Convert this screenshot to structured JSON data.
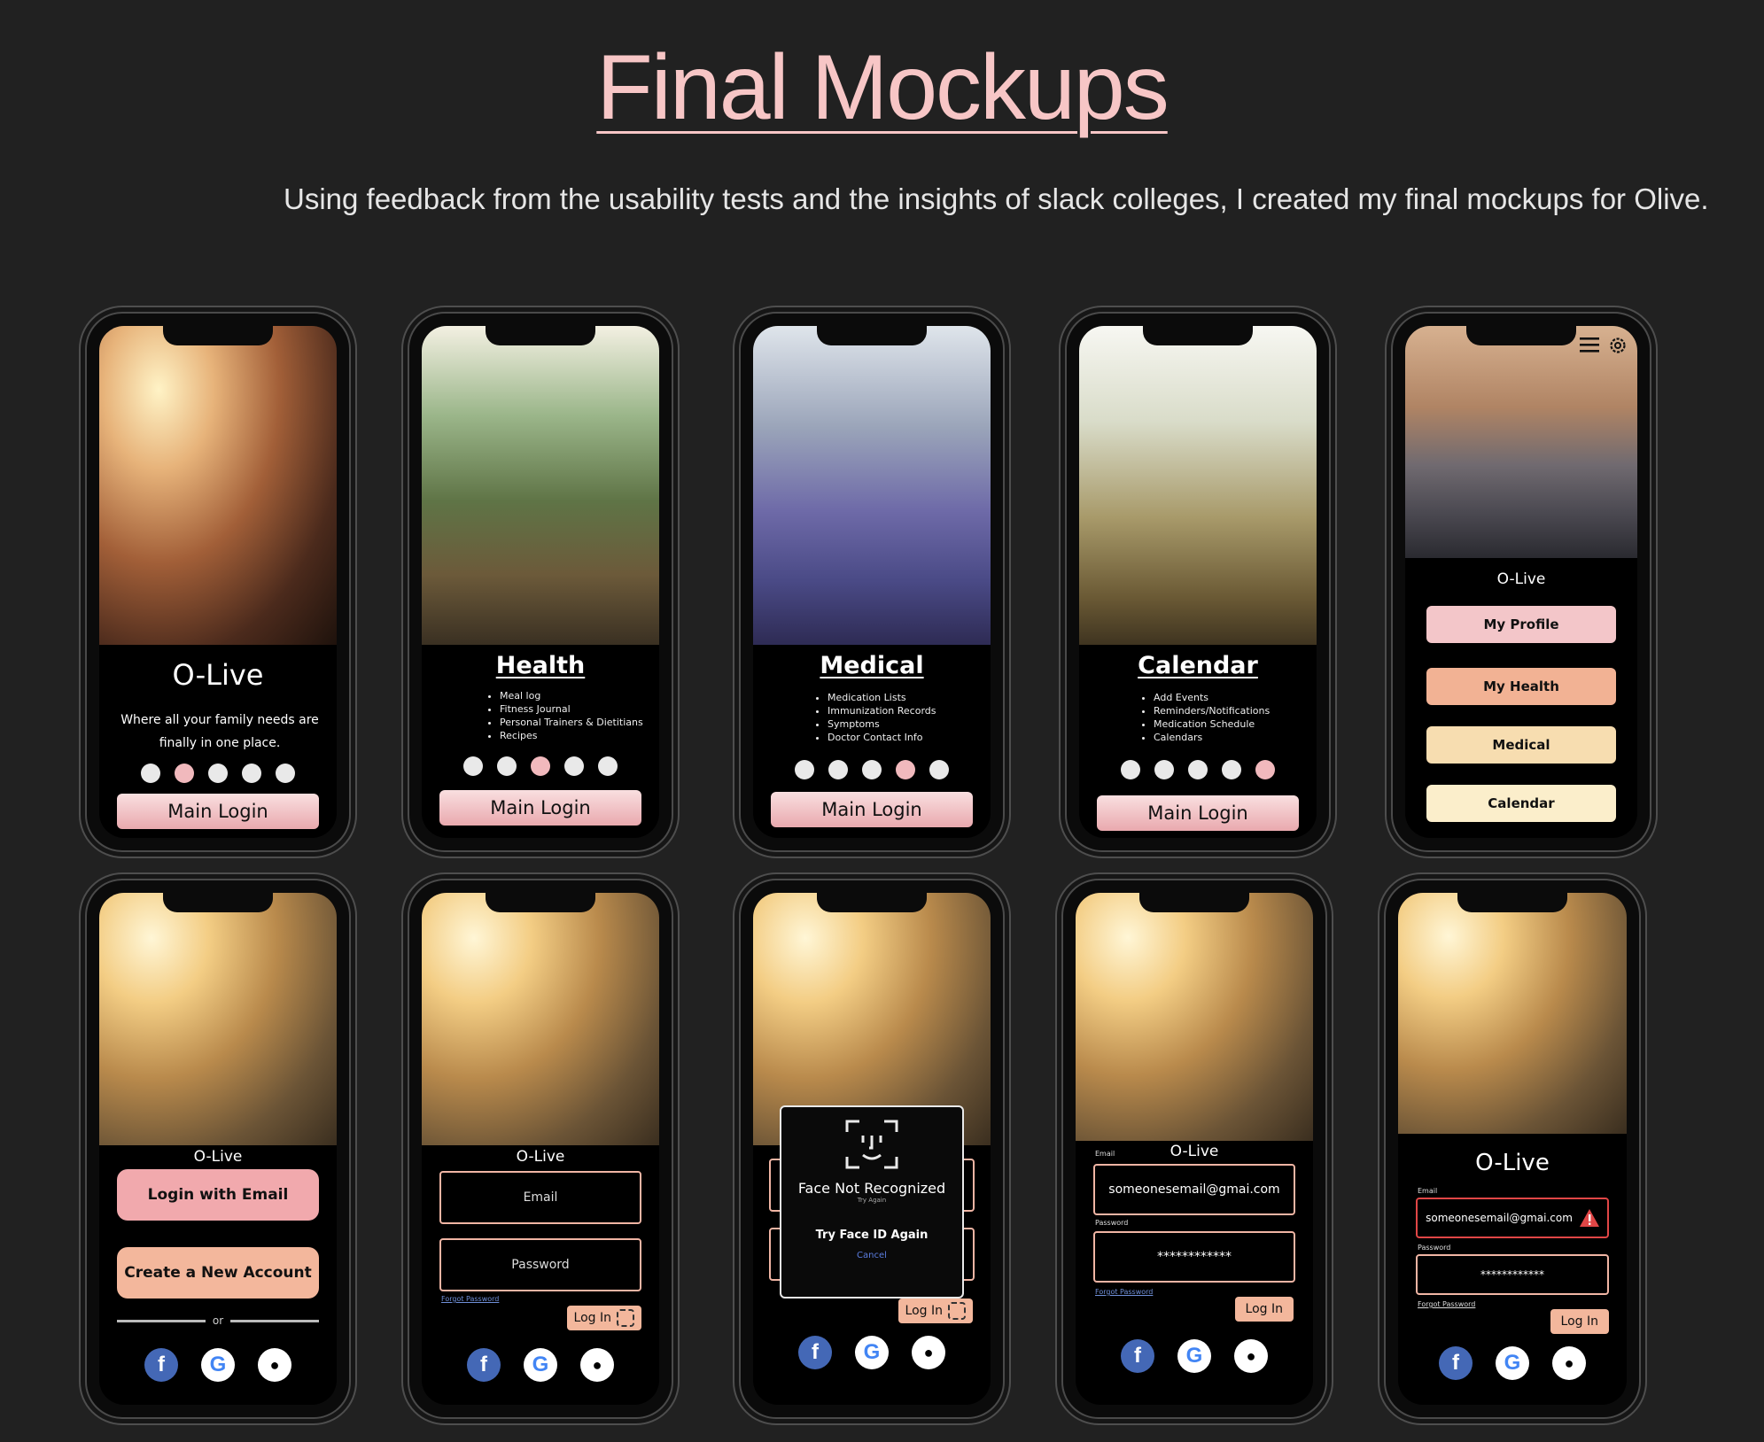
{
  "page": {
    "title": "Final Mockups",
    "subtitle": "Using feedback from the usability tests and the insights of slack colleges, I created my final mockups for Olive."
  },
  "onboarding": [
    {
      "app_name": "O-Live",
      "tagline": "Where all your family needs are finally in one place.",
      "button": "Main Login"
    },
    {
      "heading": "Health",
      "items": [
        "Meal log",
        "Fitness Journal",
        "Personal Trainers & Dietitians",
        "Recipes"
      ],
      "button": "Main Login"
    },
    {
      "heading": "Medical",
      "items": [
        "Medication Lists",
        "Immunization Records",
        "Symptoms",
        "Doctor Contact Info"
      ],
      "button": "Main Login"
    },
    {
      "heading": "Calendar",
      "items": [
        "Add Events",
        "Reminders/Notifications",
        "Medication Schedule",
        "Calendars"
      ],
      "button": "Main Login"
    }
  ],
  "home_menu": {
    "app_name": "O-Live",
    "buttons": [
      "My Profile",
      "My Health",
      "Medical",
      "Calendar"
    ],
    "colors": [
      "#f3c6c9",
      "#f2b294",
      "#f7ddb0",
      "#fbeecb"
    ]
  },
  "login_choice": {
    "app_name": "O-Live",
    "login_email": "Login with Email",
    "create_account": "Create a New Account",
    "or": "or"
  },
  "login_form": {
    "app_name": "O-Live",
    "email_placeholder": "Email",
    "password_placeholder": "Password",
    "forgot": "Forgot Password",
    "login": "Log In"
  },
  "face_error": {
    "title": "Face Not Recognized",
    "sub": "Try Again",
    "retry": "Try Face ID Again",
    "cancel": "Cancel",
    "login": "Log In"
  },
  "filled_login": {
    "app_name": "O-Live",
    "email_label": "Email",
    "email_value": "someonesemail@gmai.com",
    "password_label": "Password",
    "password_value": "************",
    "forgot": "Forgot Password",
    "login": "Log In"
  },
  "error_login": {
    "app_name": "O-Live",
    "email_label": "Email",
    "email_value": "someonesemail@gmai.com",
    "password_label": "Password",
    "password_value": "************",
    "forgot": "Forgot Password",
    "login": "Log In"
  },
  "social": {
    "facebook": "f",
    "google": "G",
    "apple": "●"
  },
  "colors": {
    "title_pink": "#f7c6c6",
    "accent_pink": "#f1b9bd",
    "peach": "#f3b79c",
    "error_red": "#e04646"
  }
}
